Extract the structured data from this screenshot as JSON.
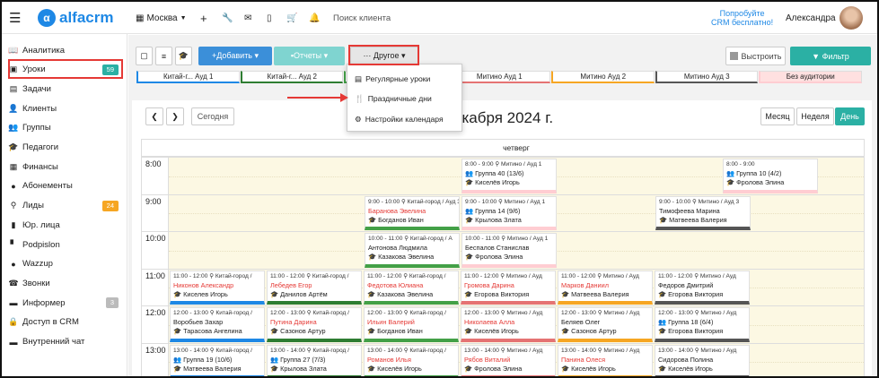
{
  "app": {
    "logo": "alfacrm",
    "branch": "Москва",
    "search_placeholder": "Поиск клиента",
    "promo_line1": "Попробуйте",
    "promo_line2": "CRM бесплатно!",
    "user": "Александра"
  },
  "sidebar": {
    "items": [
      {
        "label": "Аналитика",
        "icon": "📖"
      },
      {
        "label": "Уроки",
        "icon": "▣",
        "badge": "59",
        "active": true
      },
      {
        "label": "Задачи",
        "icon": "▤"
      },
      {
        "label": "Клиенты",
        "icon": "👤"
      },
      {
        "label": "Группы",
        "icon": "👥"
      },
      {
        "label": "Педагоги",
        "icon": "🎓"
      },
      {
        "label": "Финансы",
        "icon": "▦"
      },
      {
        "label": "Абонементы",
        "icon": "●"
      },
      {
        "label": "Лиды",
        "icon": "⚲",
        "badge": "24"
      },
      {
        "label": "Юр. лица",
        "icon": "▮"
      },
      {
        "label": "Podpislon",
        "icon": "▘"
      },
      {
        "label": "Wazzup",
        "icon": "●"
      },
      {
        "label": "Звонки",
        "icon": "☎"
      },
      {
        "label": "Информер",
        "icon": "▬",
        "badge": "3"
      },
      {
        "label": "Доступ в CRM",
        "icon": "🔒"
      },
      {
        "label": "Внутренний чат",
        "icon": "▬"
      }
    ]
  },
  "toolbar": {
    "add": "+Добавить ▾",
    "reports": "▪Отчеты ▾",
    "other": "··· Другое ▾",
    "align": "Выстроить",
    "filter": "▼ Фильтр"
  },
  "auditoriums": [
    "Китай-г... Ауд 1",
    "Китай-г... Ауд 2",
    "Китай-город / Ауд 3",
    "Митино Ауд 1",
    "Митино Ауд 2",
    "Митино Ауд 3",
    "Без аудитории"
  ],
  "menu": {
    "items": [
      "Регулярные уроки",
      "Праздничные дни",
      "Настройки календаря"
    ]
  },
  "calendar": {
    "title": "екабря 2024 г.",
    "today": "Сегодня",
    "views": [
      "Месяц",
      "Неделя",
      "День"
    ],
    "day": "четверг",
    "times": [
      "8:00",
      "9:00",
      "10:00",
      "11:00",
      "12:00",
      "13:00"
    ]
  },
  "events": [
    {
      "time": "8:00 - 9:00 ⚲ Митино / Ауд 1",
      "name": "👥 Группа 40 (13/6)",
      "teacher": "🎓 Киселёв Игорь",
      "red": false
    },
    {
      "time": "8:00 - 9:00",
      "name": "👥 Группа 10 (4/2)",
      "teacher": "🎓 Фролова Элина",
      "red": false
    },
    {
      "time": "9:00 - 10:00 ⚲ Китай-город / Ауд 3",
      "name": "Баранова Эвелина",
      "teacher": "🎓 Богданов Иван",
      "red": true
    },
    {
      "time": "9:00 - 10:00 ⚲ Митино / Ауд 1",
      "name": "👥 Группа 14 (9/6)",
      "teacher": "🎓 Крылова Злата",
      "red": false
    },
    {
      "time": "9:00 - 10:00 ⚲ Митино / Ауд 3",
      "name": "Тимофеева Марина",
      "teacher": "🎓 Матвеева Валерия",
      "red": false
    },
    {
      "time": "10:00 - 11:00 ⚲ Китай-город / А",
      "name": "Антонова Людмила",
      "teacher": "🎓 Казакова Эвелина",
      "red": false
    },
    {
      "time": "10:00 - 11:00 ⚲ Митино / Ауд 1",
      "name": "Беспалов Станислав",
      "teacher": "🎓 Фролова Элина",
      "red": false
    },
    {
      "time": "11:00 - 12:00 ⚲ Китай-город /",
      "name": "Никонов Александр",
      "teacher": "🎓 Киселев Игорь",
      "red": true
    },
    {
      "time": "11:00 - 12:00 ⚲ Китай-город /",
      "name": "Лебедев Егор",
      "teacher": "🎓 Данилов Артём",
      "red": true
    },
    {
      "time": "11:00 - 12:00 ⚲ Китай-город /",
      "name": "Федотова Юлиана",
      "teacher": "🎓 Казакова Эвелина",
      "red": true
    },
    {
      "time": "11:00 - 12:00 ⚲ Митино / Ауд",
      "name": "Громова Дарина",
      "teacher": "🎓 Егорова Виктория",
      "red": true
    },
    {
      "time": "11:00 - 12:00 ⚲ Митино / Ауд",
      "name": "Марков Даниил",
      "teacher": "🎓 Матвеева Валерия",
      "red": true
    },
    {
      "time": "11:00 - 12:00 ⚲ Митино / Ауд",
      "name": "Федоров Дмитрий",
      "teacher": "🎓 Егорова Виктория",
      "red": false
    },
    {
      "time": "12:00 - 13:00 ⚲ Китай-город /",
      "name": "Воробьев Захар",
      "teacher": "🎓 Тарасова Ангелина",
      "red": false
    },
    {
      "time": "12:00 - 13:00 ⚲ Китай-город /",
      "name": "Путина Дарина",
      "teacher": "🎓 Сазонов Артур",
      "red": true
    },
    {
      "time": "12:00 - 13:00 ⚲ Китай-город /",
      "name": "Ильин Валерий",
      "teacher": "🎓 Богданов Иван",
      "red": true
    },
    {
      "time": "12:00 - 13:00 ⚲ Митино / Ауд",
      "name": "Николаева Алла",
      "teacher": "🎓 Киселёв Игорь",
      "red": true
    },
    {
      "time": "12:00 - 13:00 ⚲ Митино / Ауд",
      "name": "Беляев Олег",
      "teacher": "🎓 Сазонов Артур",
      "red": false
    },
    {
      "time": "12:00 - 13:00 ⚲ Митино / Ауд",
      "name": "👥 Группа 18 (6/4)",
      "teacher": "🎓 Егорова Виктория",
      "red": false
    },
    {
      "time": "13:00 - 14:00 ⚲ Китай-город /",
      "name": "👥 Группа 19 (10/6)",
      "teacher": "🎓 Матвеева Валерия",
      "red": false
    },
    {
      "time": "13:00 - 14:00 ⚲ Китай-город /",
      "name": "👥 Группа 27 (7/3)",
      "teacher": "🎓 Крылова Злата",
      "red": false
    },
    {
      "time": "13:00 - 14:00 ⚲ Китай-город /",
      "name": "Романов Илья",
      "teacher": "🎓 Киселёв Игорь",
      "red": true
    },
    {
      "time": "13:00 - 14:00 ⚲ Митино / Ауд",
      "name": "Рябов Виталий",
      "teacher": "🎓 Фролова Элина",
      "red": true
    },
    {
      "time": "13:00 - 14:00 ⚲ Митино / Ауд",
      "name": "Панина Олеся",
      "teacher": "🎓 Киселёв Игорь",
      "red": true
    },
    {
      "time": "13:00 - 14:00 ⚲ Митино / Ауд",
      "name": "Сидорова Полина",
      "teacher": "🎓 Киселёв Игорь",
      "red": false
    }
  ]
}
